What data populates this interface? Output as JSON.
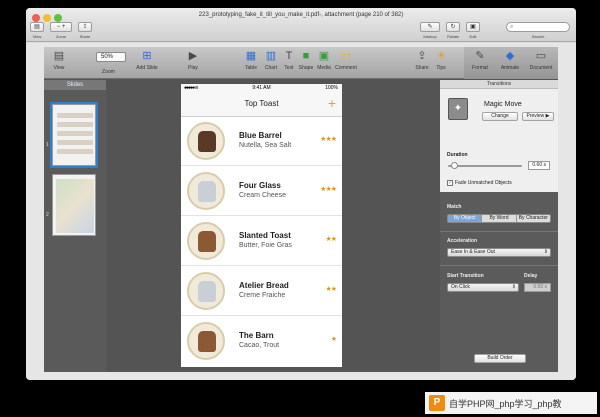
{
  "preview": {
    "title": "223_prototyping_fake_it_till_you_make_it.pdf-, attachment (page 210 of 382)",
    "toolbar": {
      "view": "View",
      "zoom": "Zoom",
      "share": "Share",
      "markup": "Markup",
      "rotate": "Rotate",
      "edit": "Edit",
      "search": "Search"
    }
  },
  "keynote": {
    "toolbar": {
      "view": "View",
      "zoom_value": "50%",
      "zoom": "Zoom",
      "add_slide": "Add Slide",
      "play": "Play",
      "table": "Table",
      "chart": "Chart",
      "text": "Text",
      "shape": "Shape",
      "media": "Media",
      "comment": "Comment",
      "share": "Share",
      "tips": "Tips",
      "format": "Format",
      "animate": "Animate",
      "document": "Document"
    },
    "sidebar": {
      "header": "Slides",
      "slide_numbers": [
        "1",
        "2"
      ]
    },
    "phone": {
      "time": "9:41 AM",
      "battery": "100%",
      "nav_title": "Top Toast",
      "plus": "+",
      "items": [
        {
          "name": "Blue Barrel",
          "sub": "Nutella, Sea Salt",
          "stars": "★★★"
        },
        {
          "name": "Four Glass",
          "sub": "Cream Cheese",
          "stars": "★★★"
        },
        {
          "name": "Slanted Toast",
          "sub": "Butter, Foie Gras",
          "stars": "★★"
        },
        {
          "name": "Atelier Bread",
          "sub": "Creme Fraiche",
          "stars": "★★"
        },
        {
          "name": "The Barn",
          "sub": "Cacao, Trout",
          "stars": "★"
        }
      ]
    },
    "inspector": {
      "tab": "Transitions",
      "effect": "Magic Move",
      "change": "Change",
      "preview": "Preview ▶",
      "duration_label": "Duration",
      "duration_value": "0.60 s",
      "fade_label": "Fade Unmatched Objects",
      "match_label": "Match",
      "match_options": [
        "By Object",
        "By Word",
        "By Character"
      ],
      "acceleration_label": "Acceleration",
      "acceleration_value": "Ease In & Ease Out",
      "start_label": "Start Transition",
      "start_value": "On Click",
      "delay_label": "Delay",
      "delay_value": "0.50 s",
      "build_order": "Build Order"
    }
  },
  "watermark": {
    "logo": "P",
    "text": "自学PHP网_php学习_php教"
  }
}
